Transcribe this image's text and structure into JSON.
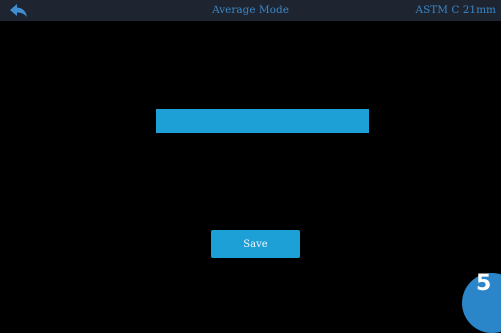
{
  "header": {
    "title": "Average Mode",
    "standard": "ASTM C 21mm",
    "back_icon": "back-arrow-icon"
  },
  "main": {
    "average_value": "",
    "save_label": "Save"
  },
  "corner_badge": {
    "label": "5"
  },
  "colors": {
    "background": "#000000",
    "header_bg": "#1e2530",
    "header_text": "#3a86c8",
    "accent": "#1ca0d6",
    "badge": "#2a85c9"
  }
}
